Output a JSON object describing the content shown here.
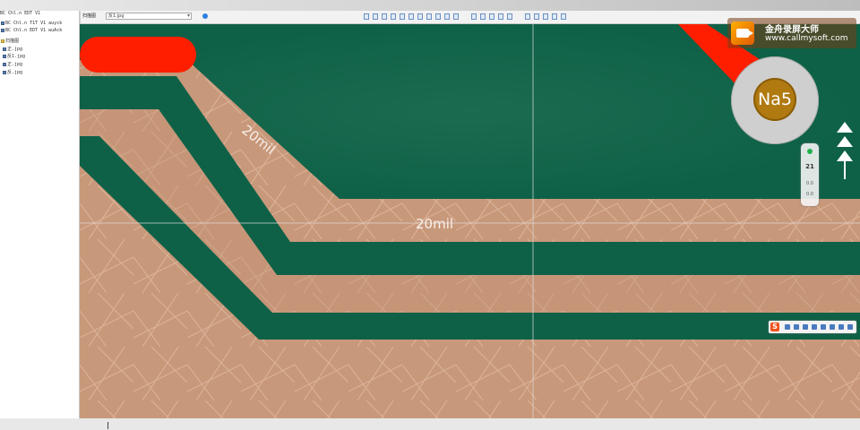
{
  "app": {
    "left_panel": {
      "title": "BC Chl.n EDT V1",
      "items": [
        {
          "label": "BC Chl.n T1T V1 auyck",
          "icon": "file-icon"
        },
        {
          "label": "BC Chl.n EDT V1 wuAck",
          "icon": "file-icon"
        },
        {
          "label": "扫描图",
          "icon": "folder-icon"
        },
        {
          "label": "正.jpg",
          "icon": "image-file-icon"
        },
        {
          "label": "反1.jpg",
          "icon": "image-file-icon"
        },
        {
          "label": "正.jpg",
          "icon": "image-file-icon"
        },
        {
          "label": "反.jpg",
          "icon": "image-file-icon"
        }
      ]
    },
    "toolbar": {
      "tab_label": "扫描图",
      "layer_select_value": "反1.jpg",
      "icons": [
        "info-icon",
        "pointer-icon",
        "select-icon",
        "zoom-icon",
        "pan-icon",
        "measure-icon",
        "text-icon",
        "line-icon",
        "rect-icon",
        "layers-icon",
        "grid-icon",
        "ruler-icon",
        "settings-icon"
      ]
    },
    "canvas": {
      "annotations": [
        {
          "text": "20mil",
          "target": "diagonal-trace"
        },
        {
          "text": "20mil",
          "target": "horizontal-trace"
        }
      ],
      "colors": {
        "solder_mask": "#0e6147",
        "copper": "#c8987a",
        "pad": "#ff1f00",
        "board_bg": "#1c5a44"
      }
    }
  },
  "overlays": {
    "watermark": {
      "line1": "金舟录屏大师",
      "line2": "www.callmysoft.com"
    },
    "badge": {
      "text": "Na5"
    },
    "side_panel": {
      "value": "21",
      "num1": "0.0",
      "num2": "0.0"
    },
    "ime_bar": {
      "logo": "S"
    }
  }
}
